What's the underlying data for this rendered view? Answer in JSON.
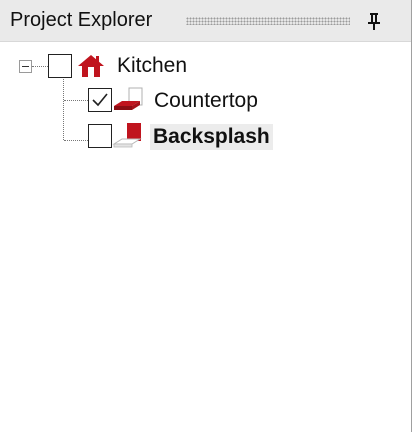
{
  "panel": {
    "title": "Project Explorer"
  },
  "tree": {
    "root": {
      "label": "Kitchen",
      "checked": false,
      "expanded": true,
      "children": [
        {
          "label": "Countertop",
          "checked": true,
          "bold": false,
          "selected": false
        },
        {
          "label": "Backsplash",
          "checked": false,
          "bold": true,
          "selected": true
        }
      ]
    }
  },
  "colors": {
    "accent": "#c0141e",
    "title_bar": "#eaeaea",
    "selection": "#ececec"
  },
  "icons": {
    "pin": "pin-icon",
    "root": "house-icon",
    "child1": "countertop-icon",
    "child2": "backsplash-icon"
  }
}
